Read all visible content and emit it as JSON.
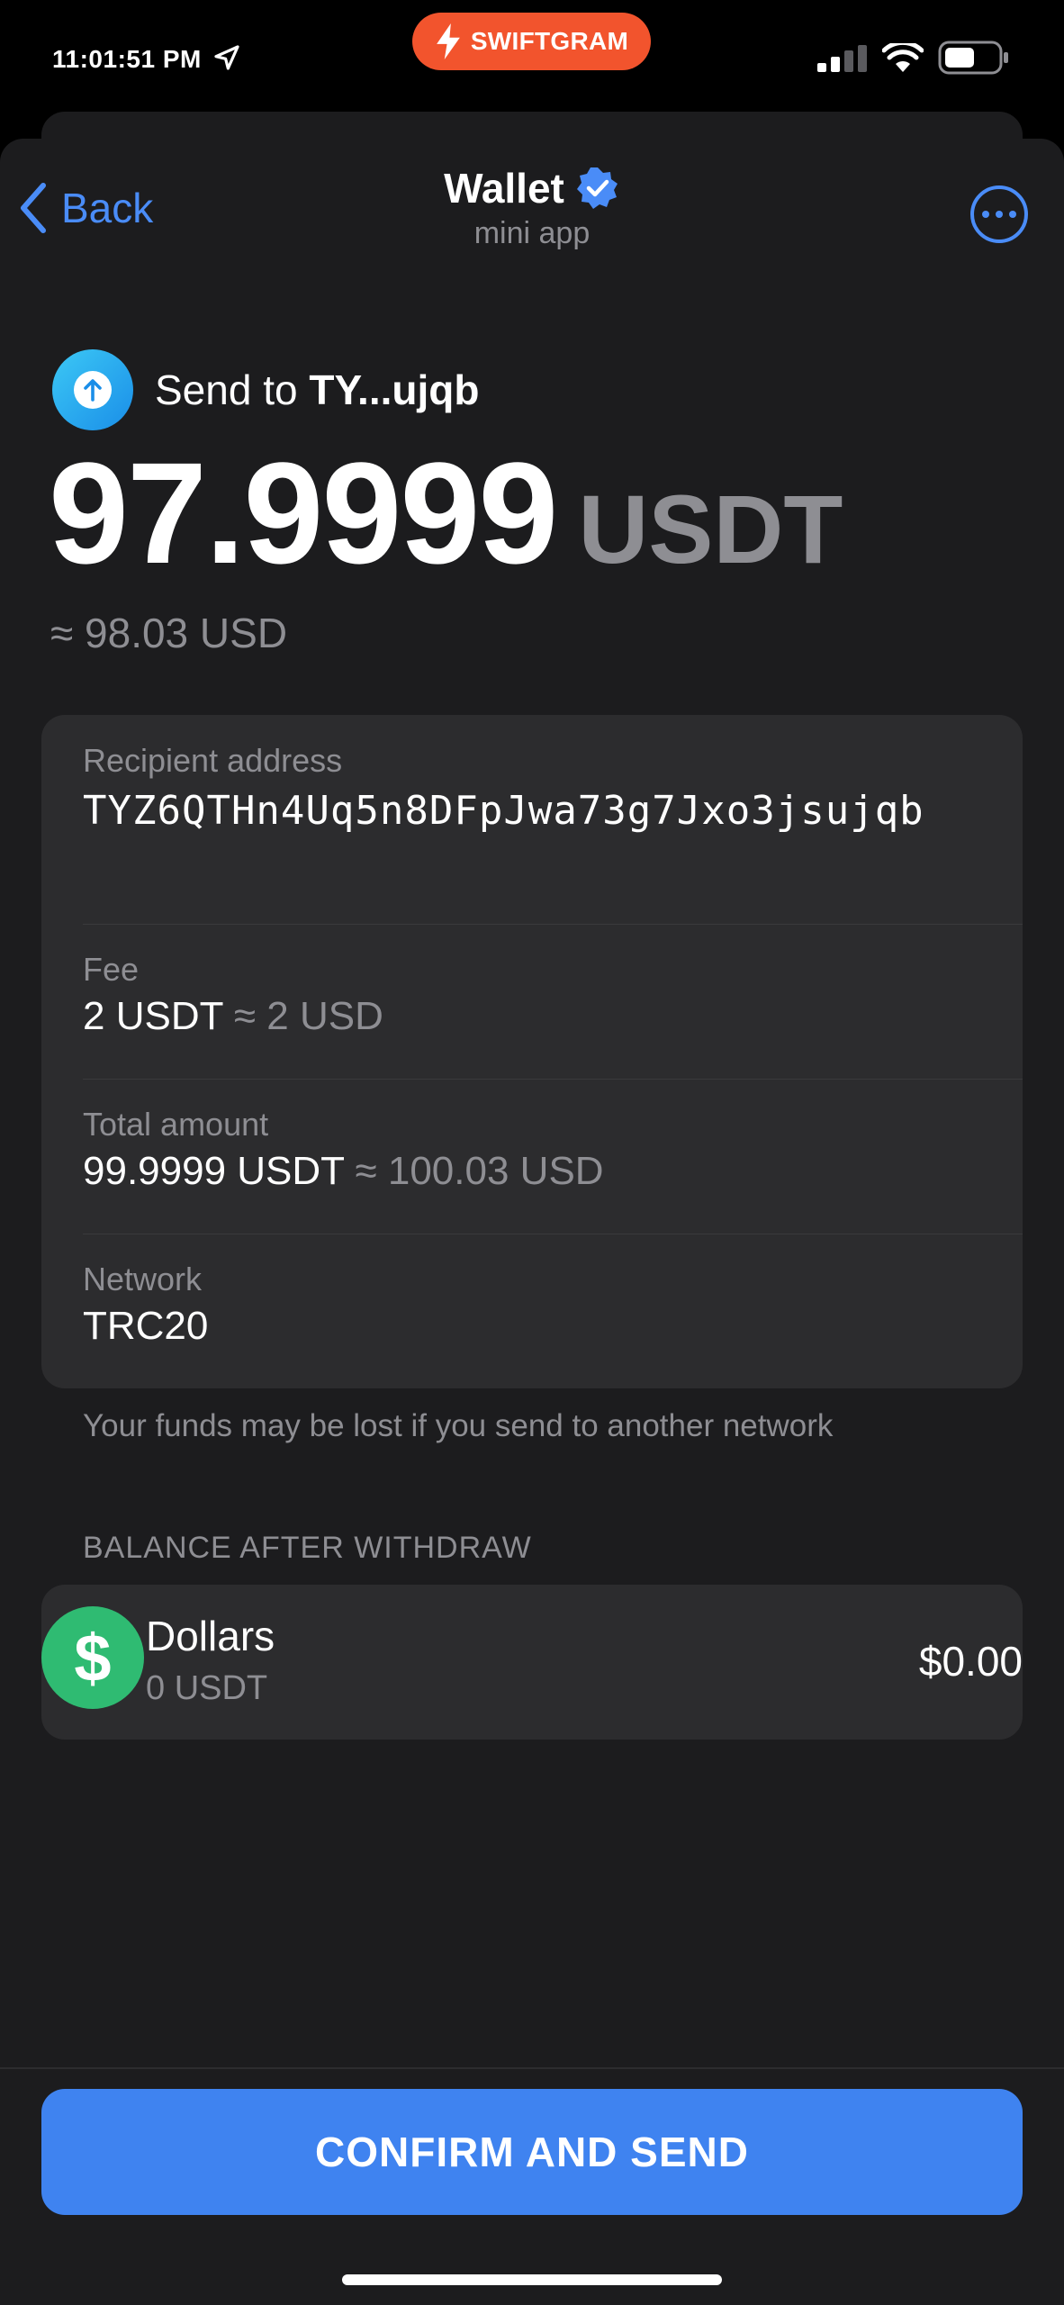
{
  "status_bar": {
    "time": "11:01:51 PM",
    "badge_label": "SWIFTGRAM",
    "badge_color": "#f2542d"
  },
  "nav": {
    "back_label": "Back",
    "title": "Wallet",
    "subtitle": "mini app"
  },
  "transfer": {
    "send_prefix": "Send to ",
    "send_address_short": "TY...ujqb",
    "amount": "97.9999",
    "currency": "USDT",
    "fiat_approx": "≈ 98.03 USD"
  },
  "details": {
    "recipient_label": "Recipient address",
    "recipient_value": "TYZ6QTHn4Uq5n8DFpJwa73g7Jxo3jsujqb",
    "fee_label": "Fee",
    "fee_value": "2 USDT",
    "fee_fiat": " ≈ 2 USD",
    "total_label": "Total amount",
    "total_value": "99.9999 USDT",
    "total_fiat": " ≈ 100.03 USD",
    "network_label": "Network",
    "network_value": "TRC20"
  },
  "warning": "Your funds may be lost if you send to another network",
  "balance": {
    "section_title": "BALANCE AFTER WITHDRAW",
    "icon_symbol": "$",
    "name": "Dollars",
    "amount": "0 USDT",
    "fiat": "$0.00"
  },
  "confirm_label": "CONFIRM AND SEND",
  "colors": {
    "accent": "#3f83f0",
    "link": "#4a8cf7",
    "dollar_icon": "#2fbb72",
    "background": "#1c1c1e",
    "card": "#2c2c2e"
  }
}
